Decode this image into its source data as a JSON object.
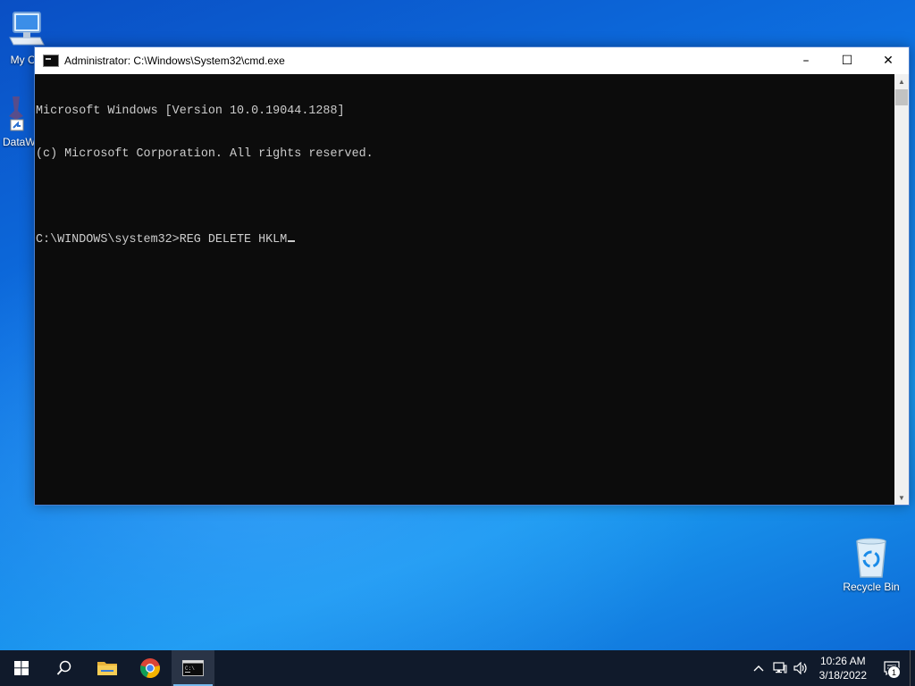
{
  "desktop": {
    "icons": [
      {
        "name": "my-computer",
        "label": "My Co"
      },
      {
        "name": "datawarrior",
        "label": "DataW"
      },
      {
        "name": "recycle-bin",
        "label": "Recycle Bin"
      }
    ]
  },
  "window": {
    "title": "Administrator: C:\\Windows\\System32\\cmd.exe",
    "controls": {
      "minimize": "–",
      "maximize": "☐",
      "close": "✕"
    },
    "console_lines": [
      "Microsoft Windows [Version 10.0.19044.1288]",
      "(c) Microsoft Corporation. All rights reserved.",
      "",
      "C:\\WINDOWS\\system32>REG DELETE HKLM"
    ]
  },
  "taskbar": {
    "buttons": [
      {
        "name": "start-button",
        "icon": "windows-logo-icon"
      },
      {
        "name": "search-button",
        "icon": "search-icon"
      },
      {
        "name": "file-explorer-button",
        "icon": "folder-icon"
      },
      {
        "name": "chrome-button",
        "icon": "chrome-icon"
      },
      {
        "name": "cmd-button",
        "icon": "terminal-icon",
        "active": true
      }
    ],
    "clock": {
      "time": "10:26 AM",
      "date": "3/18/2022"
    },
    "notification_count": "1"
  },
  "colors": {
    "console_bg": "#0c0c0c",
    "console_fg": "#cccccc",
    "taskbar_bg": "#101a2b"
  }
}
